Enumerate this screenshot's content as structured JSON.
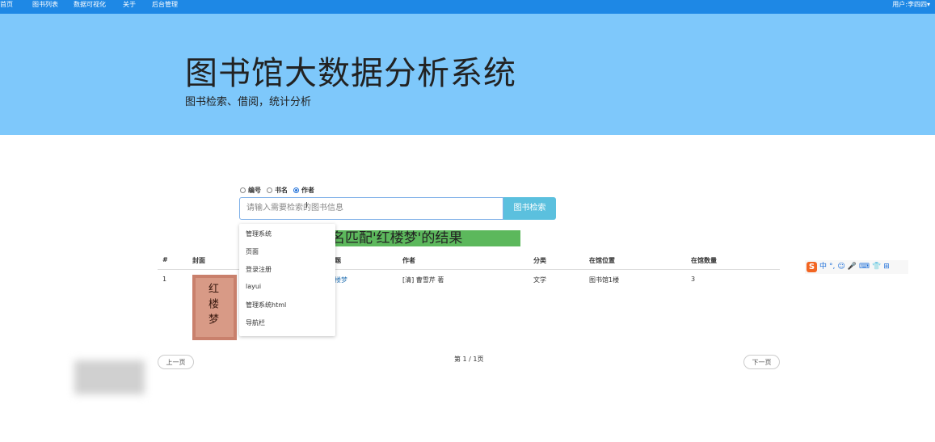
{
  "nav": {
    "items": [
      "首页",
      "图书列表",
      "数据可视化",
      "关于",
      "后台管理"
    ],
    "user": "用户:李四四▾"
  },
  "hero": {
    "title": "图书馆大数据分析系统",
    "subtitle": "图书检索、借阅，统计分析"
  },
  "search": {
    "options": [
      {
        "label": "编号",
        "checked": false
      },
      {
        "label": "书名",
        "checked": false
      },
      {
        "label": "作者",
        "checked": true
      }
    ],
    "placeholder": "请输入需要检索的图书信息",
    "button": "图书检索",
    "suggestions": [
      "管理系统",
      "页面",
      "登录注册",
      "layui",
      "管理系统html",
      "导航栏"
    ]
  },
  "result_banner": "名匹配'红楼梦'的结果",
  "table": {
    "headers": [
      "#",
      "封面",
      "题",
      "作者",
      "分类",
      "在馆位置",
      "在馆数量"
    ],
    "rows": [
      {
        "index": "1",
        "title": "楼梦",
        "author": "[清] 曹雪芹 著",
        "category": "文学",
        "location": "图书馆1楼",
        "count": "3",
        "cover_text": "红楼梦"
      }
    ]
  },
  "pagination": {
    "prev": "上一页",
    "info": "第 1 / 1页",
    "next": "下一页"
  },
  "ime_toolbar": {
    "logo": "S",
    "items": [
      "中",
      "°,",
      "☺",
      "🎤",
      "⌨",
      "👕",
      "⊞"
    ]
  },
  "colors": {
    "navbar": "#1e88e5",
    "hero": "#7ec8fb",
    "search_button": "#5bc0de",
    "result_banner": "#5cb85c"
  }
}
